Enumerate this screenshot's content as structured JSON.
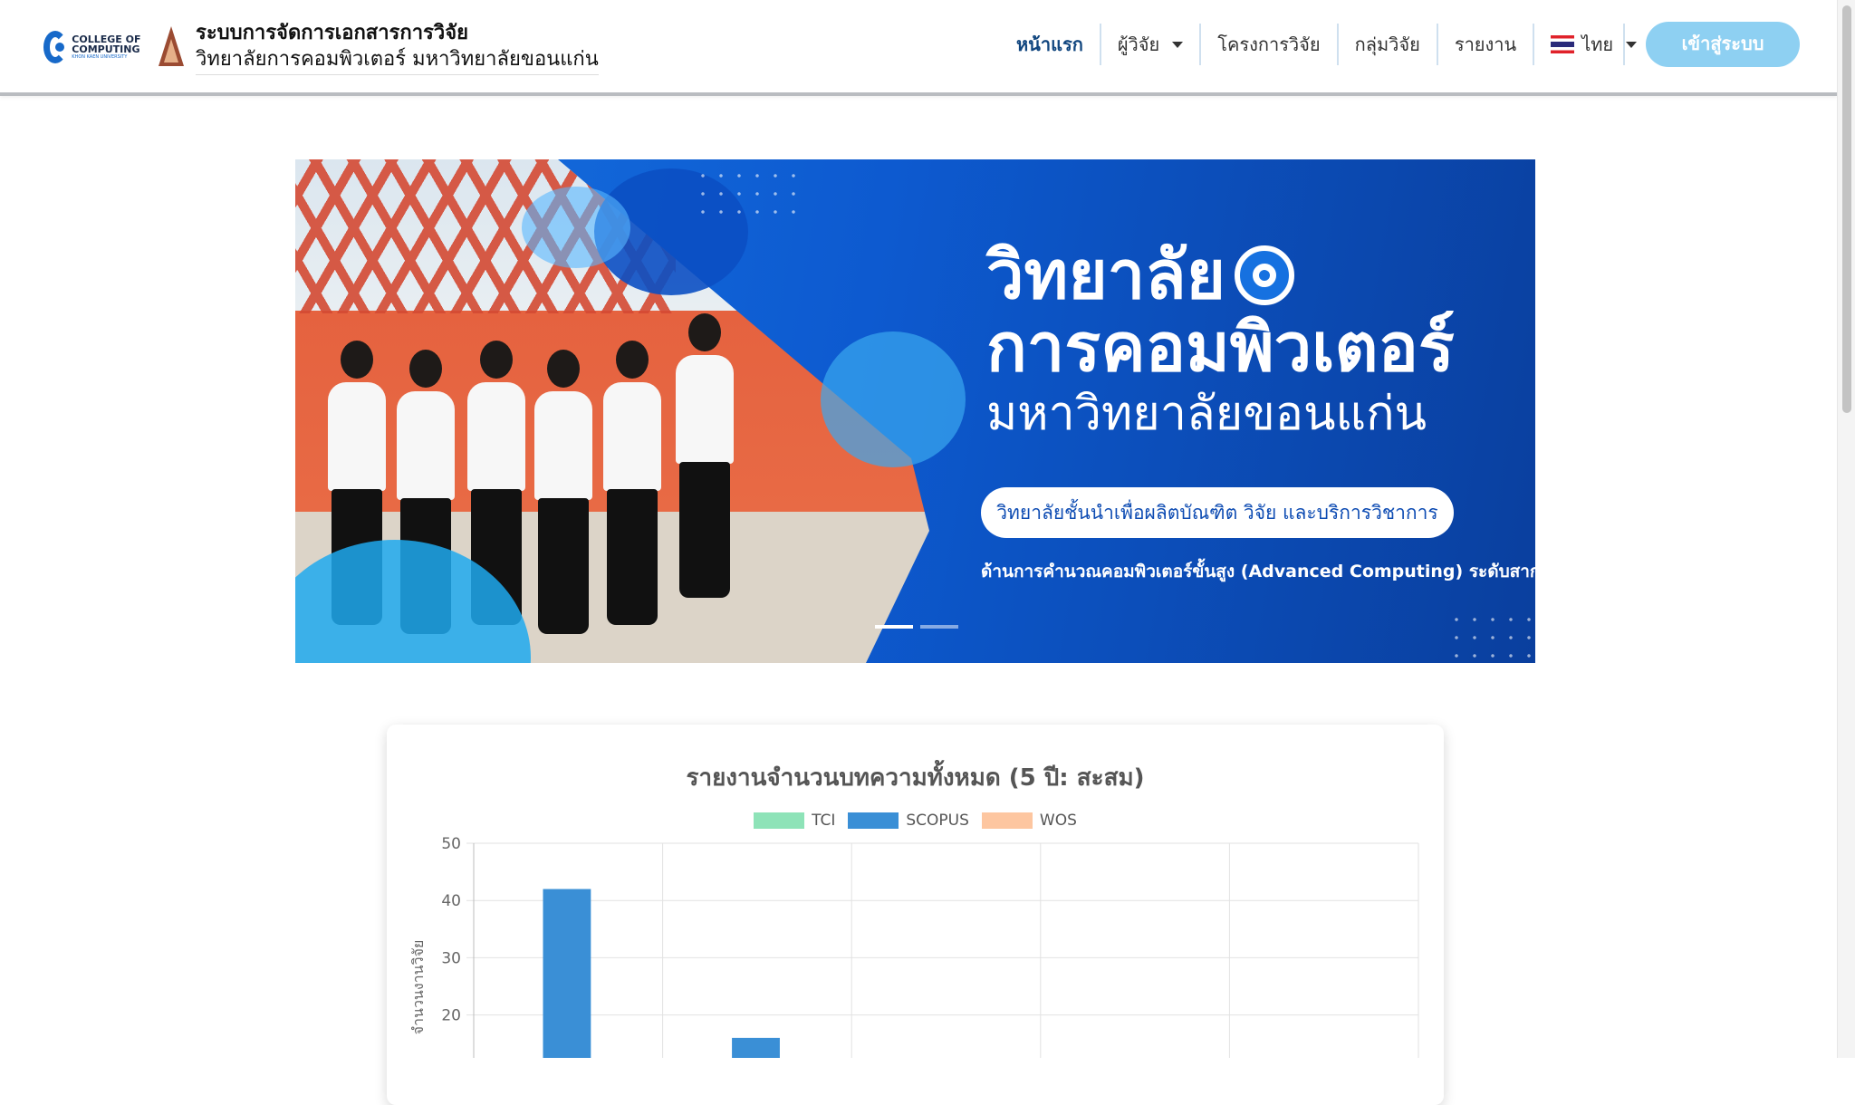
{
  "header": {
    "brand_logo_text": "COLLEGE OF COMPUTING",
    "brand_logo_sub": "KHON KAEN UNIVERSITY",
    "title": "ระบบการจัดการเอกสารการวิจัย",
    "subtitle": "วิทยาลัยการคอมพิวเตอร์ มหาวิทยาลัยขอนแก่น"
  },
  "nav": {
    "home": "หน้าแรก",
    "researchers": "ผู้วิจัย",
    "projects": "โครงการวิจัย",
    "groups": "กลุ่มวิจัย",
    "reports": "รายงาน",
    "language": "ไทย",
    "login": "เข้าสู่ระบบ"
  },
  "banner": {
    "line1": "วิทยาลัย",
    "line2": "การคอมพิวเตอร์",
    "line3": "มหาวิทยาลัยขอนแก่น",
    "pill": "วิทยาลัยชั้นนำเพื่อผลิตบัณฑิต วิจัย  และบริการวิชาการ",
    "tagline": "ด้านการคำนวณคอมพิวเตอร์ขั้นสูง (Advanced Computing) ระดับสากล",
    "next_icon": "chevron-right-icon",
    "slides": 2,
    "active_slide": 1
  },
  "colors": {
    "brand_blue": "#1769c9",
    "nav_active": "#11467f",
    "login_bg": "#8ed0f2",
    "banner_blue": "#0d5ad0"
  },
  "chart_data": {
    "type": "bar",
    "title": "รายงานจำนวนบทความทั้งหมด (5 ปี: สะสม)",
    "ylabel": "จำนวนงานวิจัย",
    "ylim": [
      0,
      50
    ],
    "yticks": [
      50,
      40,
      30,
      20
    ],
    "grid": true,
    "legend_position": "top",
    "category_count": 5,
    "series": [
      {
        "name": "TCI",
        "color": "#8ee3b8",
        "values": []
      },
      {
        "name": "SCOPUS",
        "color": "#3a8fd6",
        "values": [
          42,
          16
        ]
      },
      {
        "name": "WOS",
        "color": "#fdc6a0",
        "values": []
      }
    ]
  }
}
